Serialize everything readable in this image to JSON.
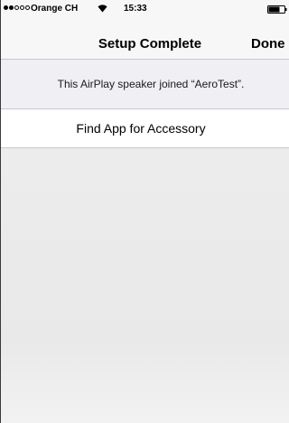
{
  "status_bar": {
    "carrier": "Orange CH",
    "time": "15:33",
    "signal_filled": 2,
    "signal_total": 5
  },
  "nav": {
    "title": "Setup Complete",
    "done_label": "Done"
  },
  "message": "This AirPlay speaker joined “AeroTest”.",
  "cell": {
    "label": "Find App for Accessory"
  }
}
